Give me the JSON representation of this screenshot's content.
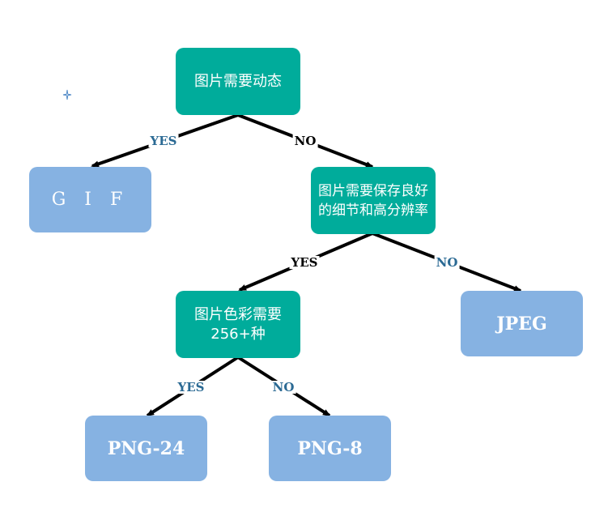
{
  "nodes": {
    "q_dynamic": "图片需要动态",
    "q_detail": "图片需要保存良好的细节和高分辨率",
    "q_color": "图片色彩需要256+种",
    "r_gif": "G I F",
    "r_jpeg": "JPEG",
    "r_png24": "PNG-24",
    "r_png8": "PNG-8"
  },
  "edges": {
    "dynamic_yes": "YES",
    "dynamic_no": "NO",
    "detail_yes": "YES",
    "detail_no": "NO",
    "color_yes": "YES",
    "color_no": "NO"
  },
  "colors": {
    "decision": "#00ac9b",
    "result": "#86b2e2",
    "label_blue": "#2b6a94",
    "edge": "#000000"
  }
}
